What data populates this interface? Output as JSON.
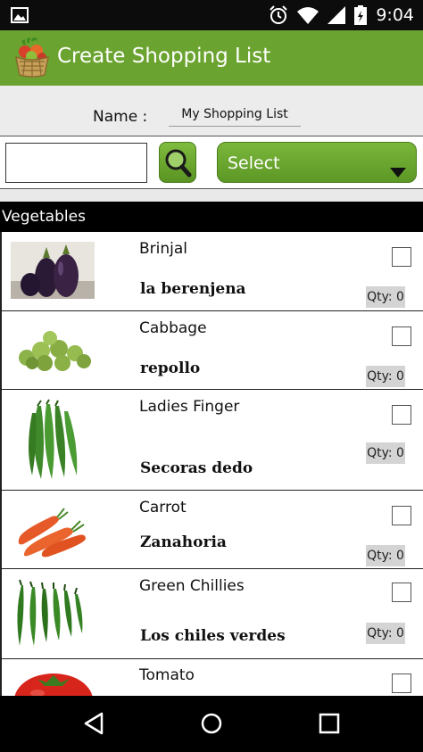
{
  "status_bar": {
    "time": "9:04",
    "icons": [
      "image-icon",
      "alarm-icon",
      "wifi-icon",
      "signal-icon",
      "battery-icon"
    ]
  },
  "action_bar": {
    "title": "Create Shopping List",
    "logo_icon": "vegetable-basket-icon",
    "bg_color": "#6aa32f"
  },
  "name_row": {
    "label": "Name :",
    "value": "My Shopping List"
  },
  "search_row": {
    "input_value": "",
    "search_icon": "search-icon",
    "select_label": "Select"
  },
  "category": {
    "title": "Vegetables"
  },
  "items": [
    {
      "name": "Brinjal",
      "spanish": "la berenjena",
      "qty": "Qty: 0",
      "checked": false,
      "icon": "brinjal-image"
    },
    {
      "name": "Cabbage",
      "spanish": "repollo",
      "qty": "Qty: 0",
      "checked": false,
      "icon": "cabbage-image"
    },
    {
      "name": "Ladies Finger",
      "spanish": "Secoras dedo",
      "qty": "Qty: 0",
      "checked": false,
      "icon": "okra-image"
    },
    {
      "name": "Carrot",
      "spanish": "Zanahoria",
      "qty": "Qty: 0",
      "checked": false,
      "icon": "carrot-image"
    },
    {
      "name": "Green Chillies",
      "spanish": "Los chiles verdes",
      "qty": "Qty: 0",
      "checked": false,
      "icon": "chilli-image"
    },
    {
      "name": "Tomato",
      "checked": false,
      "icon": "tomato-image"
    }
  ],
  "nav_bar": {
    "icons": [
      "back-icon",
      "home-icon",
      "recents-icon"
    ]
  }
}
